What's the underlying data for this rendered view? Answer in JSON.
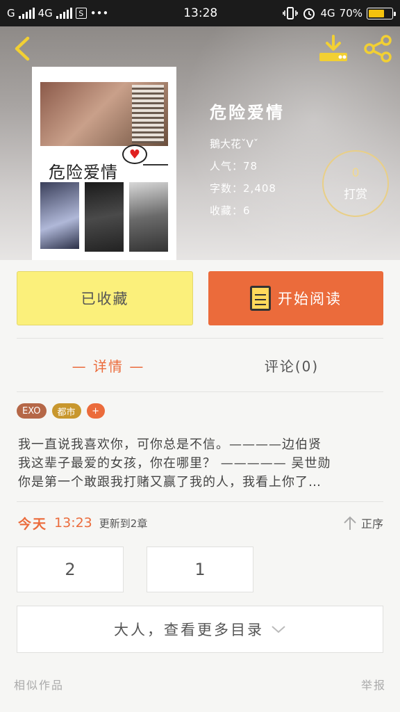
{
  "status_bar": {
    "carrier": "G",
    "network": "4G",
    "time": "13:28",
    "network2": "4G",
    "battery": "70%",
    "battery_level": 0.7
  },
  "book": {
    "title": "危险爱情",
    "author": "鵝大花ˇVˇ",
    "popularity_label": "人气：",
    "popularity": "78",
    "words_label": "字数：",
    "words": "2,408",
    "favorites_label": "收藏：",
    "favorites": "6",
    "cover_title": "危险爱情"
  },
  "tip": {
    "count": "0",
    "label": "打赏"
  },
  "actions": {
    "favorited_label": "已收藏",
    "read_label": "开始阅读"
  },
  "tabs": {
    "details": "— 详情 —",
    "comments": "评论(0)"
  },
  "tags": [
    "EXO",
    "都市",
    "+"
  ],
  "description": [
    "我一直说我喜欢你，可你总是不信。————边伯贤",
    "我这辈子最爱的女孩，你在哪里？ ————— 吴世勋",
    "你是第一个敢跟我打赌又赢了我的人，我看上你了…"
  ],
  "update": {
    "today": "今天",
    "time": "13:23",
    "text": "更新到2章",
    "sort_label": "正序"
  },
  "chapters": [
    "2",
    "1"
  ],
  "more_label": "大人，查看更多目录",
  "footer": {
    "similar": "相似作品",
    "report": "举报"
  },
  "colors": {
    "accent": "#eb6b3b",
    "favorite_bg": "#fbf07b",
    "tag_exo": "#b56747",
    "tag_city": "#c8972e",
    "tip_ring": "#e9cf86"
  }
}
